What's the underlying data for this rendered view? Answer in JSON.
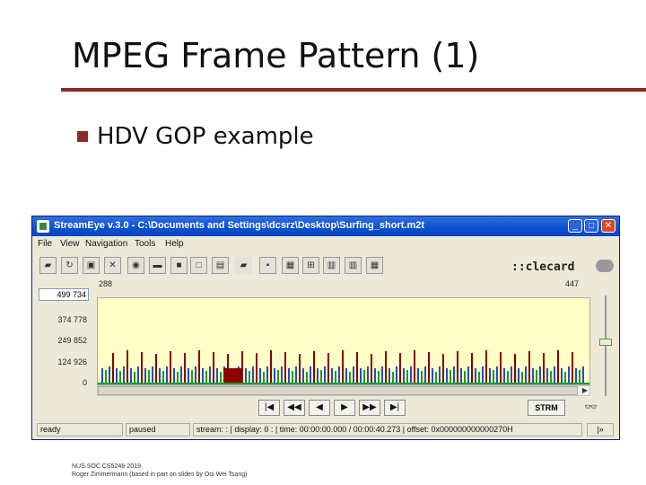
{
  "slide": {
    "title": "MPEG Frame Pattern (1)",
    "bullet": "HDV GOP example",
    "footer_line1": "NUS.SOC.CS5248-2019",
    "footer_line2": "Roger Zimmermann (based in part on slides by Ooi Wei Tsang)"
  },
  "app": {
    "title": "StreamEye v.3.0 - C:\\Documents and Settings\\dcsrz\\Desktop\\Surfing_short.m2t",
    "min_glyph": "_",
    "max_glyph": "□",
    "close_glyph": "✕",
    "menu": [
      "File",
      "View",
      "Navigation",
      "Tools",
      "Help"
    ],
    "logo_text": "::clecard",
    "ruler_left": "288",
    "ruler_right": "447",
    "y_input": "499 734",
    "y_labels": [
      "374 778",
      "249 852",
      "124 926",
      "0"
    ],
    "nav_buttons": [
      "|◀",
      "◀◀",
      "◀",
      "▶",
      "▶▶",
      "▶|"
    ],
    "strm_label": "STRM",
    "status": {
      "state": "ready",
      "playback": "paused",
      "info": "stream: : | display: 0 : | time: 00:00:00.000 / 00:00:40.273 | offset: 0x000000000000270H",
      "arrow": "|»"
    },
    "colors": {
      "titlebar": "#0b4fd0",
      "plot_bg": "#ffffc8",
      "i_frame": "#8b0000",
      "p_frame": "#1e4fc8",
      "b_frame": "#1e9a2a",
      "accent": "#8c2a2a"
    }
  },
  "chart_data": {
    "type": "bar",
    "ylim": [
      0,
      499734
    ],
    "series": [
      {
        "values": [
          0
        ]
      }
    ]
  }
}
